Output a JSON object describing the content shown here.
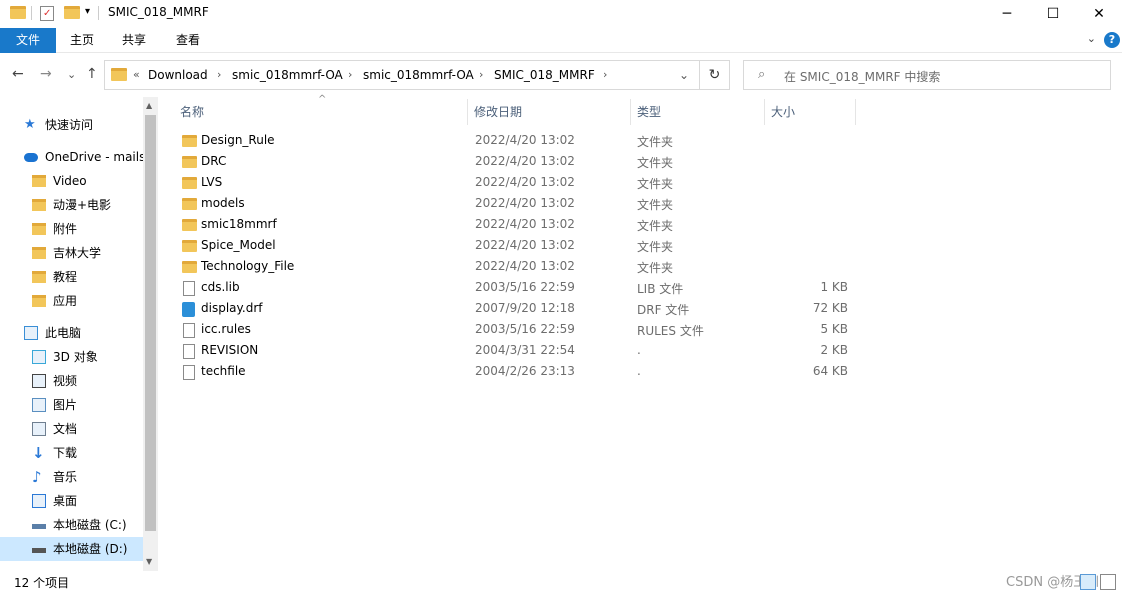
{
  "window": {
    "title": "SMIC_018_MMRF",
    "minimize_glyph": "─",
    "maximize_glyph": "☐",
    "close_glyph": "✕"
  },
  "ribbon": {
    "tabs": [
      "文件",
      "主页",
      "共享",
      "查看"
    ],
    "expand_glyph": "⌄",
    "help_glyph": "?"
  },
  "nav": {
    "back_glyph": "←",
    "forward_glyph": "→",
    "recent_glyph": "⌄",
    "up_glyph": "↑",
    "overflow": "«",
    "breadcrumbs": [
      "Download",
      "smic_018mmrf-OA",
      "smic_018mmrf-OA",
      "SMIC_018_MMRF"
    ],
    "separator": "›",
    "dropdown_glyph": "⌄",
    "refresh_glyph": "↻",
    "search_placeholder": "在 SMIC_018_MMRF 中搜索"
  },
  "sidebar": {
    "items": [
      {
        "label": "快速访问",
        "icon": "star-icon",
        "color": "#2b79d6"
      },
      {
        "label": "OneDrive - mails",
        "icon": "cloud-icon",
        "color": "#1a73d1"
      },
      {
        "label": "Video",
        "icon": "folder-icon",
        "color": "#f2c65a"
      },
      {
        "label": "动漫+电影",
        "icon": "folder-icon",
        "color": "#f2c65a"
      },
      {
        "label": "附件",
        "icon": "folder-icon",
        "color": "#f2c65a"
      },
      {
        "label": "吉林大学",
        "icon": "folder-icon",
        "color": "#f2c65a"
      },
      {
        "label": "教程",
        "icon": "folder-icon",
        "color": "#f2c65a"
      },
      {
        "label": "应用",
        "icon": "folder-icon",
        "color": "#f2c65a"
      },
      {
        "label": "此电脑",
        "icon": "computer-icon",
        "color": "#3a8fd6"
      },
      {
        "label": "3D 对象",
        "icon": "cube-icon",
        "color": "#39a8d8"
      },
      {
        "label": "视频",
        "icon": "film-icon",
        "color": "#444444"
      },
      {
        "label": "图片",
        "icon": "picture-icon",
        "color": "#5a8fc0"
      },
      {
        "label": "文档",
        "icon": "document-icon",
        "color": "#6f7f90"
      },
      {
        "label": "下载",
        "icon": "download-icon",
        "color": "#2b79d6"
      },
      {
        "label": "音乐",
        "icon": "music-icon",
        "color": "#2b79d6"
      },
      {
        "label": "桌面",
        "icon": "desktop-icon",
        "color": "#2b79d6"
      },
      {
        "label": "本地磁盘 (C:)",
        "icon": "windows-drive-icon",
        "color": "#5b7fa8"
      },
      {
        "label": "本地磁盘 (D:)",
        "icon": "drive-icon",
        "color": "#555555"
      }
    ],
    "scroll_up_glyph": "▲",
    "scroll_down_glyph": "▼"
  },
  "columns": {
    "name": "名称",
    "date": "修改日期",
    "type": "类型",
    "size": "大小",
    "sort_glyph": "^"
  },
  "files": [
    {
      "name": "Design_Rule",
      "date": "2022/4/20 13:02",
      "type": "文件夹",
      "size": "",
      "icon": "folder"
    },
    {
      "name": "DRC",
      "date": "2022/4/20 13:02",
      "type": "文件夹",
      "size": "",
      "icon": "folder"
    },
    {
      "name": "LVS",
      "date": "2022/4/20 13:02",
      "type": "文件夹",
      "size": "",
      "icon": "folder"
    },
    {
      "name": "models",
      "date": "2022/4/20 13:02",
      "type": "文件夹",
      "size": "",
      "icon": "folder"
    },
    {
      "name": "smic18mmrf",
      "date": "2022/4/20 13:02",
      "type": "文件夹",
      "size": "",
      "icon": "folder"
    },
    {
      "name": "Spice_Model",
      "date": "2022/4/20 13:02",
      "type": "文件夹",
      "size": "",
      "icon": "folder"
    },
    {
      "name": "Technology_File",
      "date": "2022/4/20 13:02",
      "type": "文件夹",
      "size": "",
      "icon": "folder"
    },
    {
      "name": "cds.lib",
      "date": "2003/5/16 22:59",
      "type": "LIB 文件",
      "size": "1 KB",
      "icon": "file"
    },
    {
      "name": "display.drf",
      "date": "2007/9/20 12:18",
      "type": "DRF 文件",
      "size": "72 KB",
      "icon": "drf"
    },
    {
      "name": "icc.rules",
      "date": "2003/5/16 22:59",
      "type": "RULES 文件",
      "size": "5 KB",
      "icon": "file"
    },
    {
      "name": "REVISION",
      "date": "2004/3/31 22:54",
      "type": ".",
      "size": "2 KB",
      "icon": "file"
    },
    {
      "name": "techfile",
      "date": "2004/2/26 23:13",
      "type": ".",
      "size": "64 KB",
      "icon": "file"
    }
  ],
  "status": {
    "count": "12 个项目",
    "watermark": "CSDN @杨玉川"
  }
}
